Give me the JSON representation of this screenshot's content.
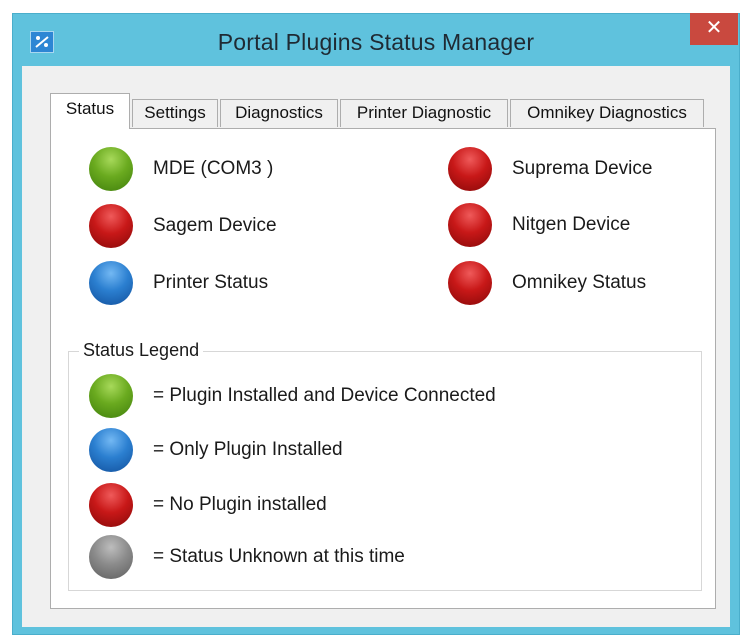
{
  "window": {
    "title": "Portal Plugins Status Manager",
    "close_label": "✕",
    "icon": "plugin-wrench-icon"
  },
  "tabs": [
    {
      "label": "Status",
      "active": true
    },
    {
      "label": "Settings",
      "active": false
    },
    {
      "label": "Diagnostics",
      "active": false
    },
    {
      "label": "Printer Diagnostic",
      "active": false
    },
    {
      "label": "Omnikey Diagnostics",
      "active": false
    }
  ],
  "devices": {
    "left": [
      {
        "label": "MDE (COM3 )",
        "status": "green"
      },
      {
        "label": "Sagem Device",
        "status": "red"
      },
      {
        "label": "Printer Status",
        "status": "blue"
      }
    ],
    "right": [
      {
        "label": "Suprema Device",
        "status": "red"
      },
      {
        "label": "Nitgen Device",
        "status": "red"
      },
      {
        "label": "Omnikey Status",
        "status": "red"
      }
    ]
  },
  "legend": {
    "title": "Status Legend",
    "items": [
      {
        "label": "= Plugin Installed and Device Connected",
        "status": "green"
      },
      {
        "label": "= Only Plugin Installed",
        "status": "blue"
      },
      {
        "label": "= No Plugin installed",
        "status": "red"
      },
      {
        "label": "= Status Unknown at this time",
        "status": "gray"
      }
    ]
  },
  "colors": {
    "titlebar": "#5fc2dd",
    "close": "#c9493f",
    "green": "#6aaa1f",
    "red": "#c81818",
    "blue": "#2b7fd0",
    "gray": "#8b8b8b"
  }
}
